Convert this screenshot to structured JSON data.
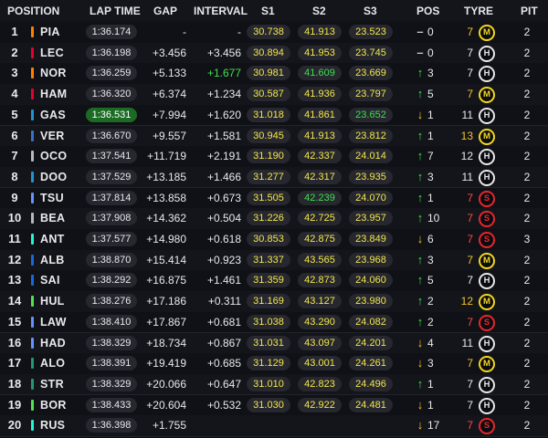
{
  "headers": {
    "position": "POSITION",
    "lap_time": "LAP TIME",
    "gap": "GAP",
    "interval": "INTERVAL",
    "s1": "S1",
    "s2": "S2",
    "s3": "S3",
    "pos": "POS",
    "tyre": "TYRE",
    "pit": "PIT"
  },
  "colors": {
    "sector_yellow": "#f3e74a",
    "sector_green": "#3fe04b",
    "fastest_lap_bg": "#1b6b25",
    "arrow_up": "#3fd84a",
    "arrow_down": "#f4c020",
    "tyre_medium": "#f3d61e",
    "tyre_hard": "#e8e8ea",
    "tyre_soft": "#e8262b"
  },
  "rows": [
    {
      "pos": "1",
      "code": "PIA",
      "team": "#ff8000",
      "lap": "1:36.174",
      "lap_fastest": false,
      "gap": "-",
      "interval": "-",
      "interval_gain": false,
      "s1": "30.738",
      "s2": "41.913",
      "s3": "23.523",
      "s1_best": false,
      "s2_best": false,
      "s3_best": false,
      "arrow": "–",
      "dir": "eq",
      "change": "0",
      "laps": "7",
      "tyre": "M",
      "pit": "2"
    },
    {
      "pos": "2",
      "code": "LEC",
      "team": "#e8002d",
      "lap": "1:36.198",
      "lap_fastest": false,
      "gap": "+3.456",
      "interval": "+3.456",
      "interval_gain": false,
      "s1": "30.894",
      "s2": "41.953",
      "s3": "23.745",
      "s1_best": false,
      "s2_best": false,
      "s3_best": false,
      "arrow": "–",
      "dir": "eq",
      "change": "0",
      "laps": "7",
      "tyre": "H",
      "pit": "2"
    },
    {
      "pos": "3",
      "code": "NOR",
      "team": "#ff8000",
      "lap": "1:36.259",
      "lap_fastest": false,
      "gap": "+5.133",
      "interval": "+1.677",
      "interval_gain": true,
      "s1": "30.981",
      "s2": "41.609",
      "s3": "23.669",
      "s1_best": false,
      "s2_best": true,
      "s3_best": false,
      "arrow": "↑",
      "dir": "up",
      "change": "3",
      "laps": "7",
      "tyre": "H",
      "pit": "2"
    },
    {
      "pos": "4",
      "code": "HAM",
      "team": "#e8002d",
      "lap": "1:36.320",
      "lap_fastest": false,
      "gap": "+6.374",
      "interval": "+1.234",
      "interval_gain": false,
      "s1": "30.587",
      "s2": "41.936",
      "s3": "23.797",
      "s1_best": false,
      "s2_best": false,
      "s3_best": false,
      "arrow": "↑",
      "dir": "up",
      "change": "5",
      "laps": "7",
      "tyre": "M",
      "pit": "2"
    },
    {
      "pos": "5",
      "code": "GAS",
      "team": "#2293d1",
      "lap": "1:36.531",
      "lap_fastest": true,
      "gap": "+7.994",
      "interval": "+1.620",
      "interval_gain": false,
      "s1": "31.018",
      "s2": "41.861",
      "s3": "23.652",
      "s1_best": false,
      "s2_best": false,
      "s3_best": true,
      "arrow": "↓",
      "dir": "down",
      "change": "1",
      "laps": "11",
      "tyre": "H",
      "pit": "2"
    },
    {
      "pos": "6",
      "code": "VER",
      "team": "#3671c6",
      "lap": "1:36.670",
      "lap_fastest": false,
      "gap": "+9.557",
      "interval": "+1.581",
      "interval_gain": false,
      "s1": "30.945",
      "s2": "41.913",
      "s3": "23.812",
      "s1_best": false,
      "s2_best": false,
      "s3_best": false,
      "arrow": "↑",
      "dir": "up",
      "change": "1",
      "laps": "13",
      "tyre": "M",
      "pit": "2"
    },
    {
      "pos": "7",
      "code": "OCO",
      "team": "#b6babd",
      "lap": "1:37.541",
      "lap_fastest": false,
      "gap": "+11.719",
      "interval": "+2.191",
      "interval_gain": false,
      "s1": "31.190",
      "s2": "42.337",
      "s3": "24.014",
      "s1_best": false,
      "s2_best": false,
      "s3_best": false,
      "arrow": "↑",
      "dir": "up",
      "change": "7",
      "laps": "12",
      "tyre": "H",
      "pit": "2"
    },
    {
      "pos": "8",
      "code": "DOO",
      "team": "#2293d1",
      "lap": "1:37.529",
      "lap_fastest": false,
      "gap": "+13.185",
      "interval": "+1.466",
      "interval_gain": false,
      "s1": "31.277",
      "s2": "42.317",
      "s3": "23.935",
      "s1_best": false,
      "s2_best": false,
      "s3_best": false,
      "arrow": "↑",
      "dir": "up",
      "change": "3",
      "laps": "11",
      "tyre": "H",
      "pit": "2"
    },
    {
      "pos": "9",
      "code": "TSU",
      "team": "#6692ff",
      "lap": "1:37.814",
      "lap_fastest": false,
      "gap": "+13.858",
      "interval": "+0.673",
      "interval_gain": false,
      "s1": "31.505",
      "s2": "42.239",
      "s3": "24.070",
      "s1_best": false,
      "s2_best": true,
      "s3_best": false,
      "arrow": "↑",
      "dir": "up",
      "change": "1",
      "laps": "7",
      "tyre": "S",
      "pit": "2"
    },
    {
      "pos": "10",
      "code": "BEA",
      "team": "#b6babd",
      "lap": "1:37.908",
      "lap_fastest": false,
      "gap": "+14.362",
      "interval": "+0.504",
      "interval_gain": false,
      "s1": "31.226",
      "s2": "42.725",
      "s3": "23.957",
      "s1_best": false,
      "s2_best": false,
      "s3_best": false,
      "arrow": "↑",
      "dir": "up",
      "change": "10",
      "laps": "7",
      "tyre": "S",
      "pit": "2"
    },
    {
      "pos": "11",
      "code": "ANT",
      "team": "#27f4d2",
      "lap": "1:37.577",
      "lap_fastest": false,
      "gap": "+14.980",
      "interval": "+0.618",
      "interval_gain": false,
      "s1": "30.853",
      "s2": "42.875",
      "s3": "23.849",
      "s1_best": false,
      "s2_best": false,
      "s3_best": false,
      "arrow": "↓",
      "dir": "down",
      "change": "6",
      "laps": "7",
      "tyre": "S",
      "pit": "3"
    },
    {
      "pos": "12",
      "code": "ALB",
      "team": "#1868db",
      "lap": "1:38.870",
      "lap_fastest": false,
      "gap": "+15.414",
      "interval": "+0.923",
      "interval_gain": false,
      "s1": "31.337",
      "s2": "43.565",
      "s3": "23.968",
      "s1_best": false,
      "s2_best": false,
      "s3_best": false,
      "arrow": "↑",
      "dir": "up",
      "change": "3",
      "laps": "7",
      "tyre": "M",
      "pit": "2"
    },
    {
      "pos": "13",
      "code": "SAI",
      "team": "#1868db",
      "lap": "1:38.292",
      "lap_fastest": false,
      "gap": "+16.875",
      "interval": "+1.461",
      "interval_gain": false,
      "s1": "31.359",
      "s2": "42.873",
      "s3": "24.060",
      "s1_best": false,
      "s2_best": false,
      "s3_best": false,
      "arrow": "↑",
      "dir": "up",
      "change": "5",
      "laps": "7",
      "tyre": "H",
      "pit": "2"
    },
    {
      "pos": "14",
      "code": "HUL",
      "team": "#52e252",
      "lap": "1:38.276",
      "lap_fastest": false,
      "gap": "+17.186",
      "interval": "+0.311",
      "interval_gain": false,
      "s1": "31.169",
      "s2": "43.127",
      "s3": "23.980",
      "s1_best": false,
      "s2_best": false,
      "s3_best": false,
      "arrow": "↑",
      "dir": "up",
      "change": "2",
      "laps": "12",
      "tyre": "M",
      "pit": "2"
    },
    {
      "pos": "15",
      "code": "LAW",
      "team": "#6692ff",
      "lap": "1:38.410",
      "lap_fastest": false,
      "gap": "+17.867",
      "interval": "+0.681",
      "interval_gain": false,
      "s1": "31.038",
      "s2": "43.290",
      "s3": "24.082",
      "s1_best": false,
      "s2_best": false,
      "s3_best": false,
      "arrow": "↑",
      "dir": "up",
      "change": "2",
      "laps": "7",
      "tyre": "S",
      "pit": "2"
    },
    {
      "pos": "16",
      "code": "HAD",
      "team": "#6692ff",
      "lap": "1:38.329",
      "lap_fastest": false,
      "gap": "+18.734",
      "interval": "+0.867",
      "interval_gain": false,
      "s1": "31.031",
      "s2": "43.097",
      "s3": "24.201",
      "s1_best": false,
      "s2_best": false,
      "s3_best": false,
      "arrow": "↓",
      "dir": "down",
      "change": "4",
      "laps": "11",
      "tyre": "H",
      "pit": "2"
    },
    {
      "pos": "17",
      "code": "ALO",
      "team": "#229971",
      "lap": "1:38.391",
      "lap_fastest": false,
      "gap": "+19.419",
      "interval": "+0.685",
      "interval_gain": false,
      "s1": "31.129",
      "s2": "43.001",
      "s3": "24.261",
      "s1_best": false,
      "s2_best": false,
      "s3_best": false,
      "arrow": "↓",
      "dir": "down",
      "change": "3",
      "laps": "7",
      "tyre": "M",
      "pit": "2"
    },
    {
      "pos": "18",
      "code": "STR",
      "team": "#229971",
      "lap": "1:38.329",
      "lap_fastest": false,
      "gap": "+20.066",
      "interval": "+0.647",
      "interval_gain": false,
      "s1": "31.010",
      "s2": "42.823",
      "s3": "24.496",
      "s1_best": false,
      "s2_best": false,
      "s3_best": false,
      "arrow": "↑",
      "dir": "up",
      "change": "1",
      "laps": "7",
      "tyre": "H",
      "pit": "2"
    },
    {
      "pos": "19",
      "code": "BOR",
      "team": "#52e252",
      "lap": "1:38.433",
      "lap_fastest": false,
      "gap": "+20.604",
      "interval": "+0.532",
      "interval_gain": false,
      "s1": "31.030",
      "s2": "42.922",
      "s3": "24.481",
      "s1_best": false,
      "s2_best": false,
      "s3_best": false,
      "arrow": "↓",
      "dir": "down",
      "change": "1",
      "laps": "7",
      "tyre": "H",
      "pit": "2"
    },
    {
      "pos": "20",
      "code": "RUS",
      "team": "#27f4d2",
      "lap": "1:36.398",
      "lap_fastest": false,
      "gap": "+1.755",
      "interval": "",
      "interval_gain": false,
      "s1": "",
      "s2": "",
      "s3": "",
      "s1_best": false,
      "s2_best": false,
      "s3_best": false,
      "arrow": "↓",
      "dir": "down",
      "change": "17",
      "laps": "7",
      "tyre": "S",
      "pit": "2"
    }
  ]
}
